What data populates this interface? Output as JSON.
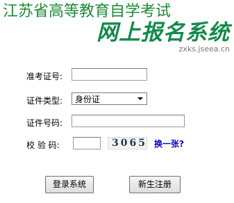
{
  "header": {
    "title_main": "江苏省高等教育自学考试",
    "title_sub": "网上报名系统",
    "domain": "zxks.jseea.cn"
  },
  "form": {
    "exam_id_label": "准考证号:",
    "exam_id_value": "",
    "id_type_label": "证件类型:",
    "id_type_selected": "身份证",
    "id_number_label": "证件号码:",
    "id_number_value": "",
    "captcha_label": "校 验 码:",
    "captcha_value": "",
    "captcha_code": "3065",
    "refresh_link": "换一张?"
  },
  "buttons": {
    "login": "登录系统",
    "register": "新生注册"
  },
  "colors": {
    "title_green": "#1d8a3a",
    "sub_green": "#138a4a",
    "link_blue": "#0000cc"
  }
}
